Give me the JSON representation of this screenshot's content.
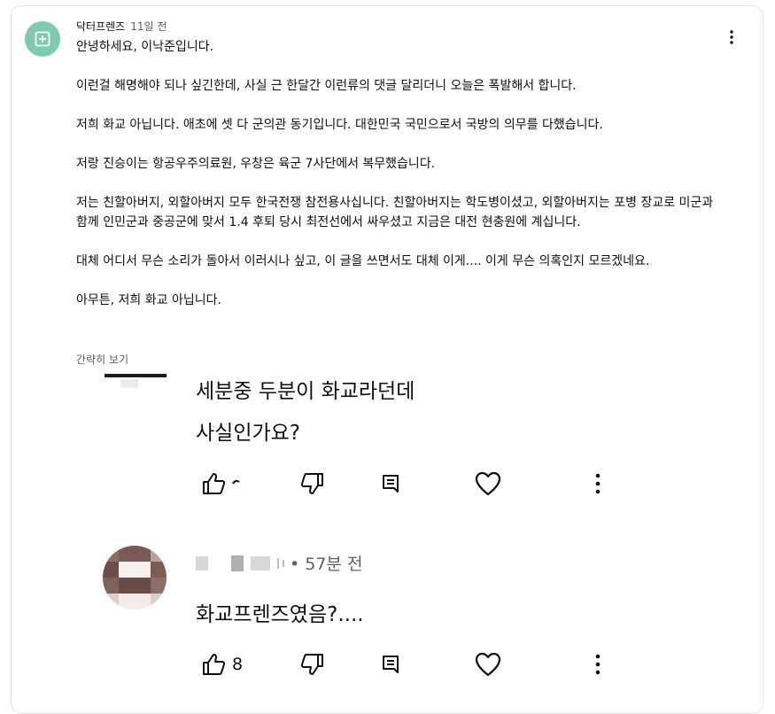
{
  "comment": {
    "author": "닥터프렌즈",
    "time": "11일 전",
    "paragraphs": [
      "안녕하세요, 이낙준입니다.",
      "이런걸 해명해야 되나 싶긴한데, 사실 근 한달간 이런류의 댓글 달리더니 오늘은 폭발해서 합니다.",
      "저희 화교 아닙니다. 애초에 셋 다 군의관 동기입니다. 대한민국 국민으로서 국방의 의무를 다했습니다.",
      "저랑 진승이는 항공우주의료원, 우창은 육군 7사단에서 복무했습니다.",
      "저는 친할아버지, 외할아버지 모두 한국전쟁 참전용사십니다. 친할아버지는 학도병이셨고, 외할아버지는 포병 장교로 미군과 함께 인민군과 중공군에 맞서 1.4 후퇴 당시 최전선에서 싸우셨고 지금은 대전 현충원에 계십니다.",
      "대체 어디서 무슨 소리가 돌아서 이러시나 싶고, 이 글을 쓰면서도 대체 이게.... 이게 무슨 의혹인지 모르겠네요.",
      "아무튼, 저희 화교 아닙니다."
    ],
    "collapse_label": "간략히 보기"
  },
  "embedded": {
    "first_comment": {
      "line1": "세분중 두분이 화교라던데",
      "line2": "사실인가요?"
    },
    "reply": {
      "time": "• 57분 전",
      "text": "화교프렌즈였음?....",
      "like_count": "8"
    }
  },
  "icons": {
    "avatar": "add-box-icon",
    "like": "thumb-up-icon",
    "dislike": "thumb-down-icon",
    "reply": "comment-icon",
    "heart": "heart-icon",
    "more": "more-vertical-icon"
  },
  "colors": {
    "avatar_bg": "#7fc9ad",
    "secondary_text": "#606060"
  }
}
